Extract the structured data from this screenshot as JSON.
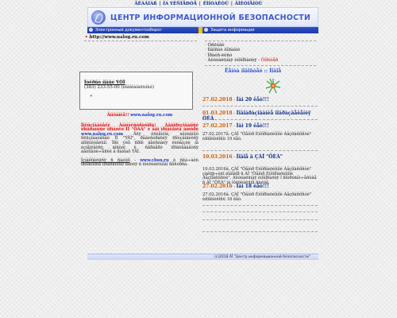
{
  "nav": {
    "items": [
      "ÃËÀÂÍÀß",
      "ÎÁ ÝÊÑÏÅÐÒÅ",
      "ÊÎÍÒÀÊÒÛ",
      "ÄÎÊÓÌÅÍÒÛ"
    ]
  },
  "banner": {
    "title": "ЦЕНТР ИНФОРМАЦИОННОЙ БЕЗОПАСНОСТИ"
  },
  "menus": {
    "left": "Электронный документооборот",
    "right": "Защита информации"
  },
  "url_line": "http://www.nalog.ru.com",
  "right_links": [
    "Óñëóãè",
    "Íîâîñòè êîìïàíèè",
    "Ïðàéñ-ëèñò",
    "Àêòóàëüíàÿ èíôîðìàöèÿ"
  ],
  "right_links_new": "Ôîðóìåð",
  "panel": {
    "line1": "Îòêðûò íîâûé ÝÖÏ",
    "line2": "(383) 233-55-00 (ìíîãîêàíàëüíûé)",
    "mark": "•"
  },
  "promo": {
    "heading": "Âíèìàíèå!!",
    "heading_link": "www.nalog.ru.com",
    "para1_red": "Ïîëüçîâàòåëè Àäìèíèñòðàòîðà! Àâòîðèçîâàííûé ïðîãðàììíûé ïðîäóêò ÏÏ \"ÖÁÀ\" è åãî ïðîäëåíèå âíóòðè",
    "para1_link": "www.nalog.ru.com",
    "para1_rest": "Äëÿ êëèåíòîâ, àêòèâíûõ ïîëüçîâàòåëåé ÏÏ \"ÝÄÎ\", ðåãèñòðàöèÿ ïðîèçâîäèòñÿ äîïîëíèòåëüíî. Ïðè ýòîì ñðîê äåéñòâèÿ ëèöåíçèè íå èçìåíÿåòñÿ, äîñòóï ê ñåðâåðó ïðîäëåâàåòñÿ àâòîìàòè÷åñêè â ðàìêàõ ÝÄÎ.",
    "para2_start": "Îçíàêîìèòüñÿ ñ ñàéòîì",
    "para2_link": "www.cbsn.ru",
    "para2_rest": "è ñêà÷àòü îáíîâëåíèå ïðîãðàììíîãî ìîäóëÿ ñ îôèöèàëüíîãî ðåñóðñà."
  },
  "news_heading": "Ëåíòà íîâîñòåé :: Íîâîå",
  "news": [
    {
      "date": "27.02.2018",
      "title": "Íàì 20 ëåò!!!",
      "body": ""
    },
    {
      "date": "01.03.2018",
      "title": "Íîâîáðàçîâàíèå ïîäðàçäåëåíèÿ ÖÈÁ",
      "body": ""
    },
    {
      "date": "27.02.2017",
      "title": "Íàì 19 ëåò!!!",
      "body": "27.02.2017ã. ÇÀÎ \"Öåíòð Èíôîðìàöèîííîé Áåçîïàñíîñòè\" èñïîëíèëîñü 19 ëåò."
    },
    {
      "date": "10.03.2016",
      "title": "Íîâîå â ÇÀÎ \"ÖÈÁ\"",
      "body": "10.03.2016ã. ÇÀÎ \"Öåíòð Èíôîðìàöèîííîé Áåçîïàñíîñòè\" çàêëþ÷èëî äîãîâîð ñ ÀÎ \"Öåíòð Èíôîðìàöèîííîé Áåçîïàñíîñòè\". Àêòóàëüíàÿ èíôîðìàöèÿ î ñîòðóäíè÷åñòâå ñ ÀÎ \"ÖÈÁ\" íà îôèöèàëüíîì ñàéòå."
    },
    {
      "date": "27.02.2016",
      "title": "Íàì 18 ëåò!!!",
      "body": "27.02.2016ã. ÇÀÎ \"Öåíòð Èíôîðìàöèîííîé Áåçîïàñíîñòè\" èñïîëíèëîñü 18 ëåò."
    }
  ],
  "footer": "(c)2018   ÀÎ \"Центр информационной безопасности\""
}
